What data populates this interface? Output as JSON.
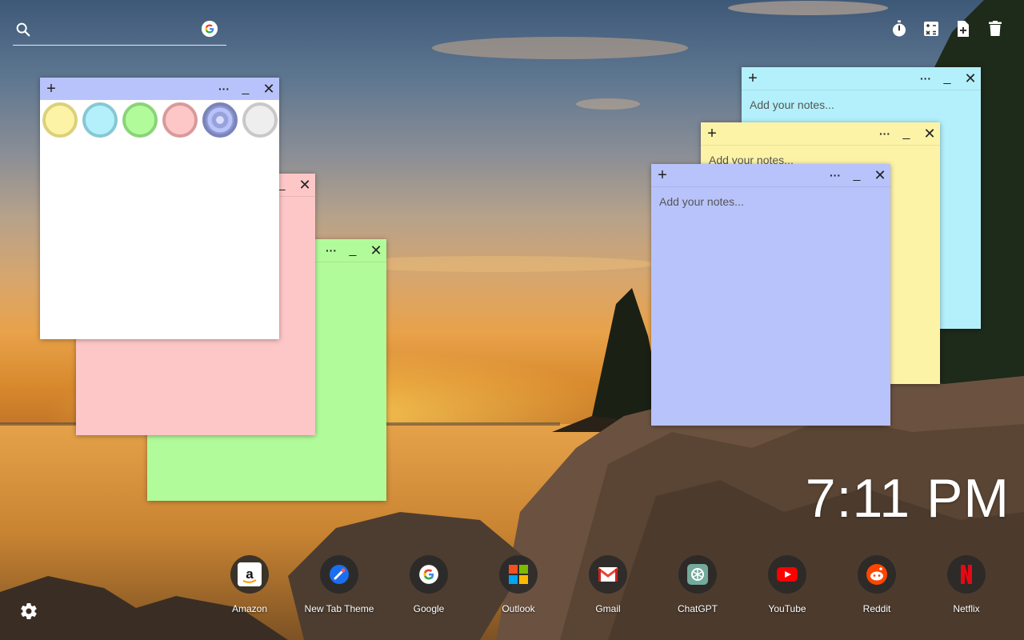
{
  "search": {
    "placeholder": ""
  },
  "clock": {
    "time": "7:11 PM"
  },
  "notes": {
    "placeholder": "Add your notes...",
    "colors": {
      "cyan": "#b3f0fb",
      "yellow": "#fdf3a7",
      "blue": "#b8c3fb",
      "pink": "#fec7c7",
      "green": "#b2fb9b",
      "white": "#ffffff"
    }
  },
  "palette": {
    "swatches": [
      "yellow",
      "cyan",
      "green",
      "pink",
      "blue",
      "gray"
    ],
    "selected": "blue"
  },
  "shortcuts": [
    {
      "label": "Amazon",
      "icon": "amazon-icon"
    },
    {
      "label": "New Tab Theme",
      "icon": "new-tab-theme-icon"
    },
    {
      "label": "Google",
      "icon": "google-icon"
    },
    {
      "label": "Outlook",
      "icon": "outlook-icon"
    },
    {
      "label": "Gmail",
      "icon": "gmail-icon"
    },
    {
      "label": "ChatGPT",
      "icon": "chatgpt-icon"
    },
    {
      "label": "YouTube",
      "icon": "youtube-icon"
    },
    {
      "label": "Reddit",
      "icon": "reddit-icon"
    },
    {
      "label": "Netflix",
      "icon": "netflix-icon"
    }
  ],
  "toolbar_icons": [
    "timer-icon",
    "calculator-icon",
    "new-note-icon",
    "trash-icon"
  ],
  "settings_icon": "gear-icon"
}
